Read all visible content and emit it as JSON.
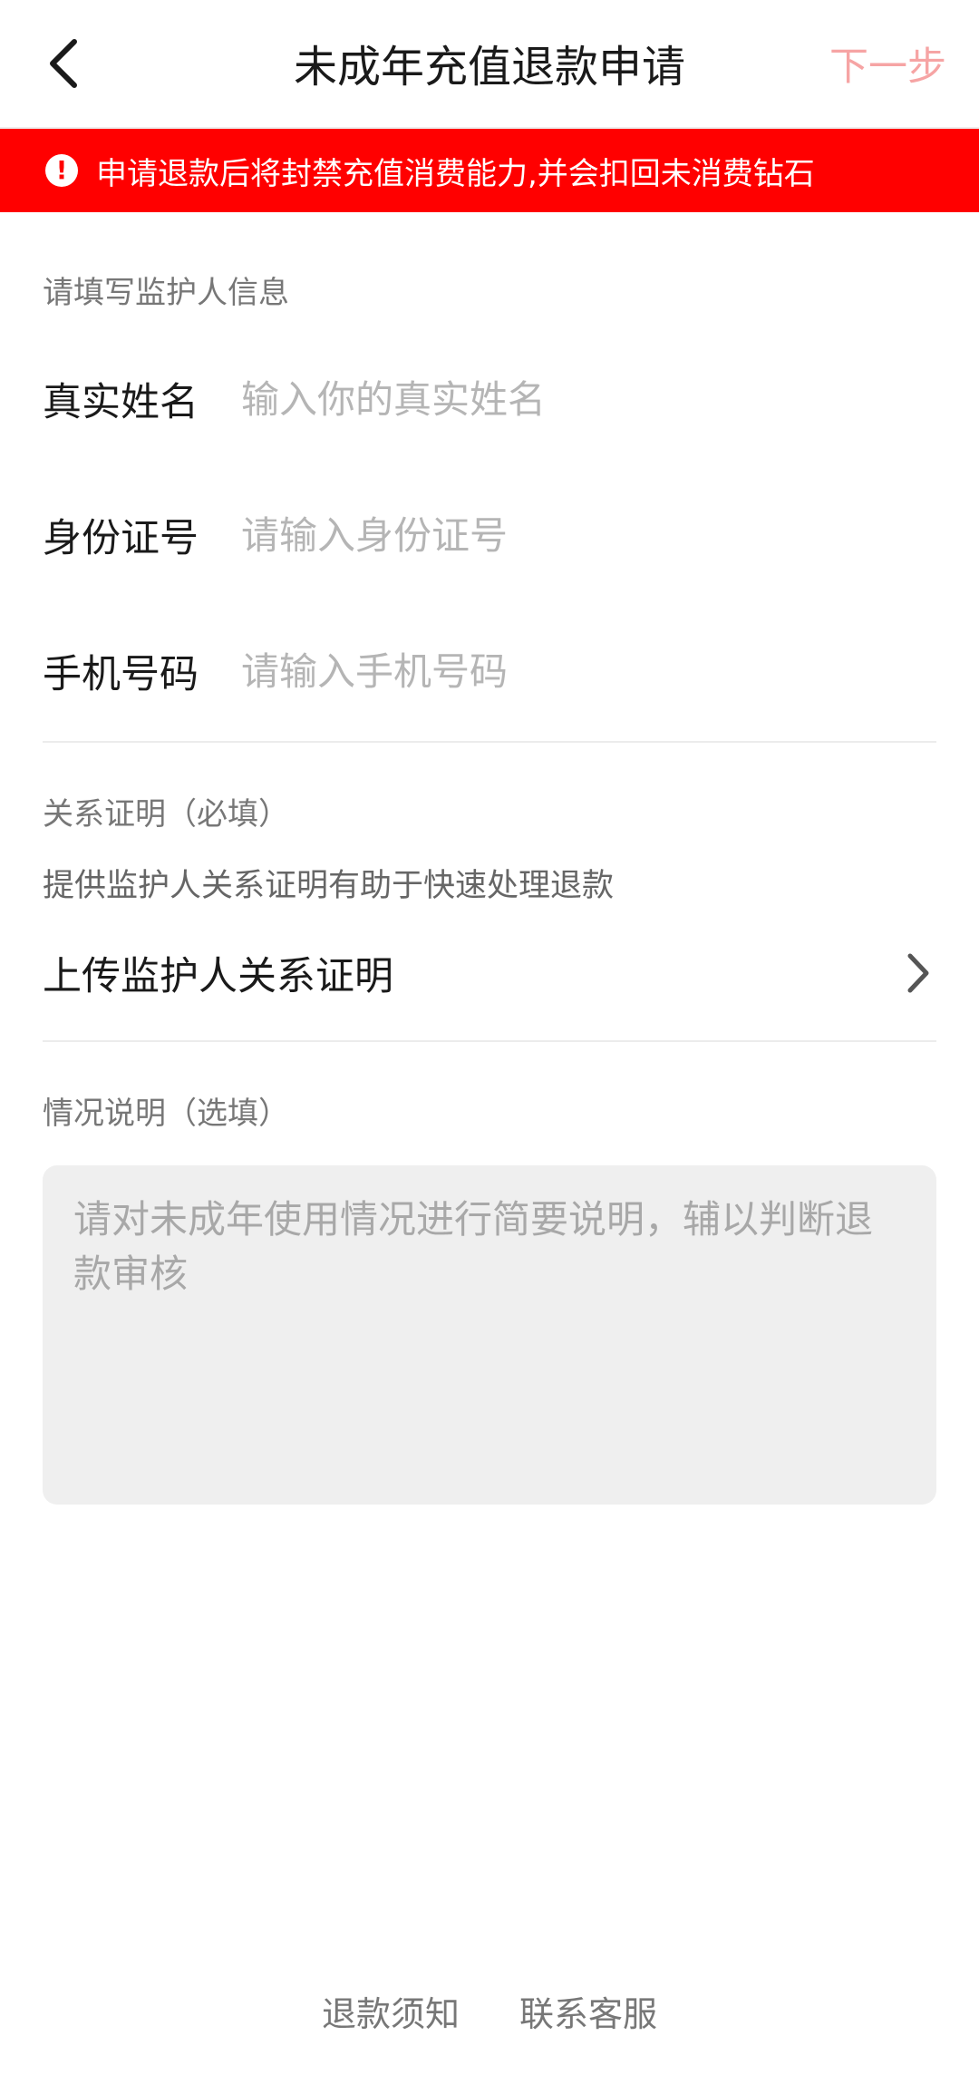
{
  "header": {
    "title": "未成年充值退款申请",
    "next_label": "下一步"
  },
  "warning": {
    "text": "申请退款后将封禁充值消费能力,并会扣回未消费钻石"
  },
  "guardian": {
    "section_label": "请填写监护人信息",
    "name_label": "真实姓名",
    "name_placeholder": "输入你的真实姓名",
    "name_value": "",
    "id_label": "身份证号",
    "id_placeholder": "请输入身份证号",
    "id_value": "",
    "phone_label": "手机号码",
    "phone_placeholder": "请输入手机号码",
    "phone_value": ""
  },
  "relation": {
    "section_label": "关系证明（必填）",
    "hint": "提供监护人关系证明有助于快速处理退款",
    "upload_label": "上传监护人关系证明"
  },
  "situation": {
    "section_label": "情况说明（选填）",
    "placeholder": "请对未成年使用情况进行简要说明，辅以判断退款审核",
    "value": ""
  },
  "footer": {
    "refund_notice": "退款须知",
    "contact_service": "联系客服"
  },
  "colors": {
    "accent_red": "#ff0000",
    "next_disabled": "#f6a4a4"
  },
  "icons": {
    "back": "chevron-left-icon",
    "warning": "exclamation-circle-icon",
    "upload_arrow": "chevron-right-icon"
  }
}
